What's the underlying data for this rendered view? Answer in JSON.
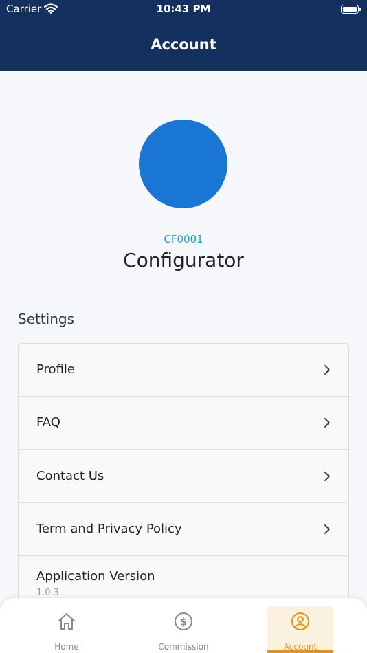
{
  "status_bar": {
    "carrier": "Carrier",
    "time": "10:43 PM"
  },
  "header": {
    "title": "Account"
  },
  "profile": {
    "code": "CF0001",
    "name": "Configurator",
    "avatar_color": "#1976d2"
  },
  "settings": {
    "title": "Settings",
    "items": [
      {
        "label": "Profile",
        "icon": "chevron-right-icon"
      },
      {
        "label": "FAQ",
        "icon": "chevron-right-icon"
      },
      {
        "label": "Contact Us",
        "icon": "chevron-right-icon"
      },
      {
        "label": "Term and Privacy Policy",
        "icon": "chevron-right-icon"
      }
    ],
    "version": {
      "label": "Application Version",
      "value": "1.0.3"
    }
  },
  "tabs": [
    {
      "label": "Home",
      "icon": "home-icon",
      "active": false
    },
    {
      "label": "Commission",
      "icon": "dollar-icon",
      "active": false
    },
    {
      "label": "Account",
      "icon": "user-icon",
      "active": true
    }
  ],
  "colors": {
    "header": "#13305e",
    "accent": "#e0941d",
    "code_text": "#1aa5d6"
  }
}
